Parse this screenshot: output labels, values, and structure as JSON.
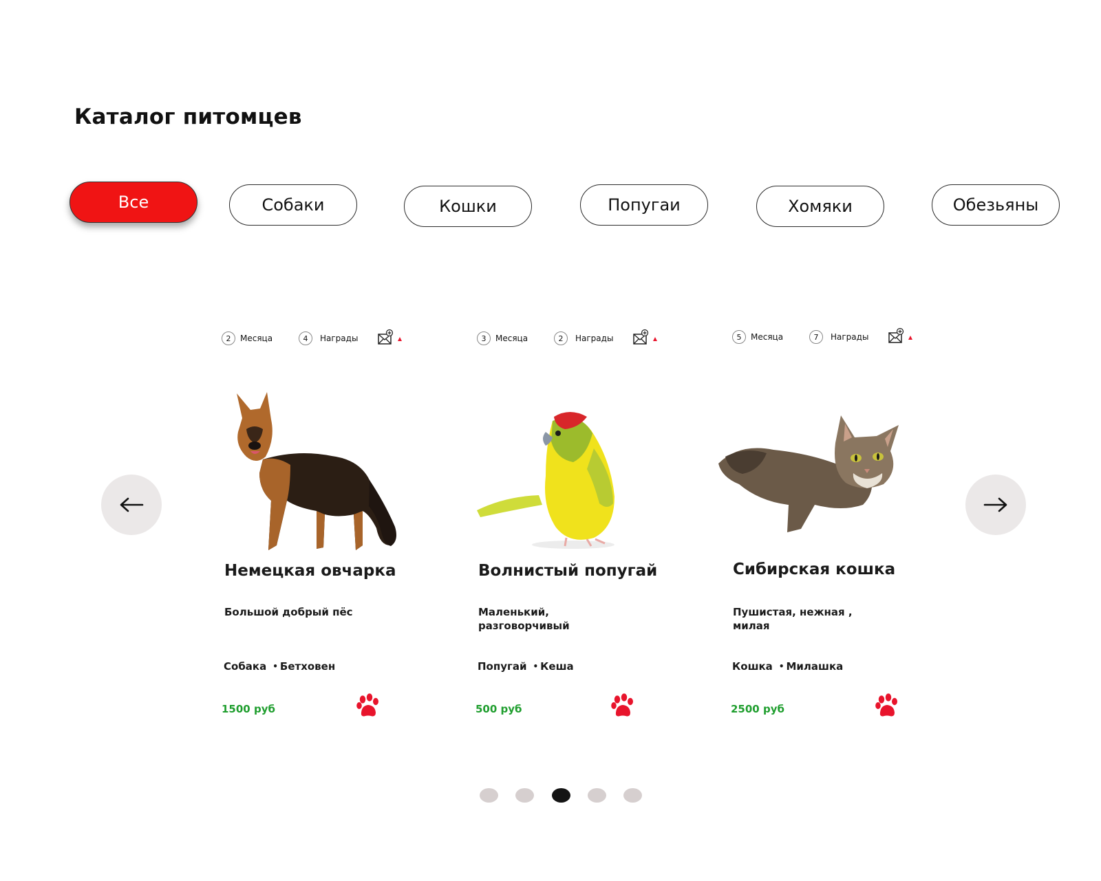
{
  "page": {
    "title": "Каталог питомцев"
  },
  "filters": [
    {
      "label": "Все",
      "active": true
    },
    {
      "label": "Собаки",
      "active": false
    },
    {
      "label": "Кошки",
      "active": false
    },
    {
      "label": "Попугаи",
      "active": false
    },
    {
      "label": "Хомяки",
      "active": false
    },
    {
      "label": "Обезьяны",
      "active": false
    }
  ],
  "carousel": {
    "prev_icon": "arrow-left-icon",
    "next_icon": "arrow-right-icon",
    "pagination": {
      "count": 5,
      "active_index": 2
    },
    "cards": [
      {
        "age_count": "2",
        "age_label": "Месяца",
        "awards_count": "4",
        "awards_label": "Награды",
        "name": "Немецкая овчарка",
        "description": "Большой добрый пёс",
        "type": "Собака",
        "nickname": "Бетховен",
        "price": "1500 руб",
        "image": "german-shepherd-photo"
      },
      {
        "age_count": "3",
        "age_label": "Месяца",
        "awards_count": "2",
        "awards_label": "Награды",
        "name": "Волнистый попугай",
        "description": "Маленький, разговорчивый",
        "type": "Попугай",
        "nickname": "Кеша",
        "price": "500 руб",
        "image": "budgie-photo"
      },
      {
        "age_count": "5",
        "age_label": "Месяца",
        "awards_count": "7",
        "awards_label": "Награды",
        "name": "Сибирская кошка",
        "description": "Пушистая, нежная , милая",
        "type": "Кошка",
        "nickname": "Милашка",
        "price": "2500 руб",
        "image": "siberian-cat-photo"
      }
    ]
  },
  "colors": {
    "accent": "#f01414",
    "price": "#1f9e2e",
    "paw": "#e8142c",
    "arrow_bg": "#ebe8e8",
    "dot_inactive": "#d6cfcf",
    "dot_active": "#141414"
  }
}
